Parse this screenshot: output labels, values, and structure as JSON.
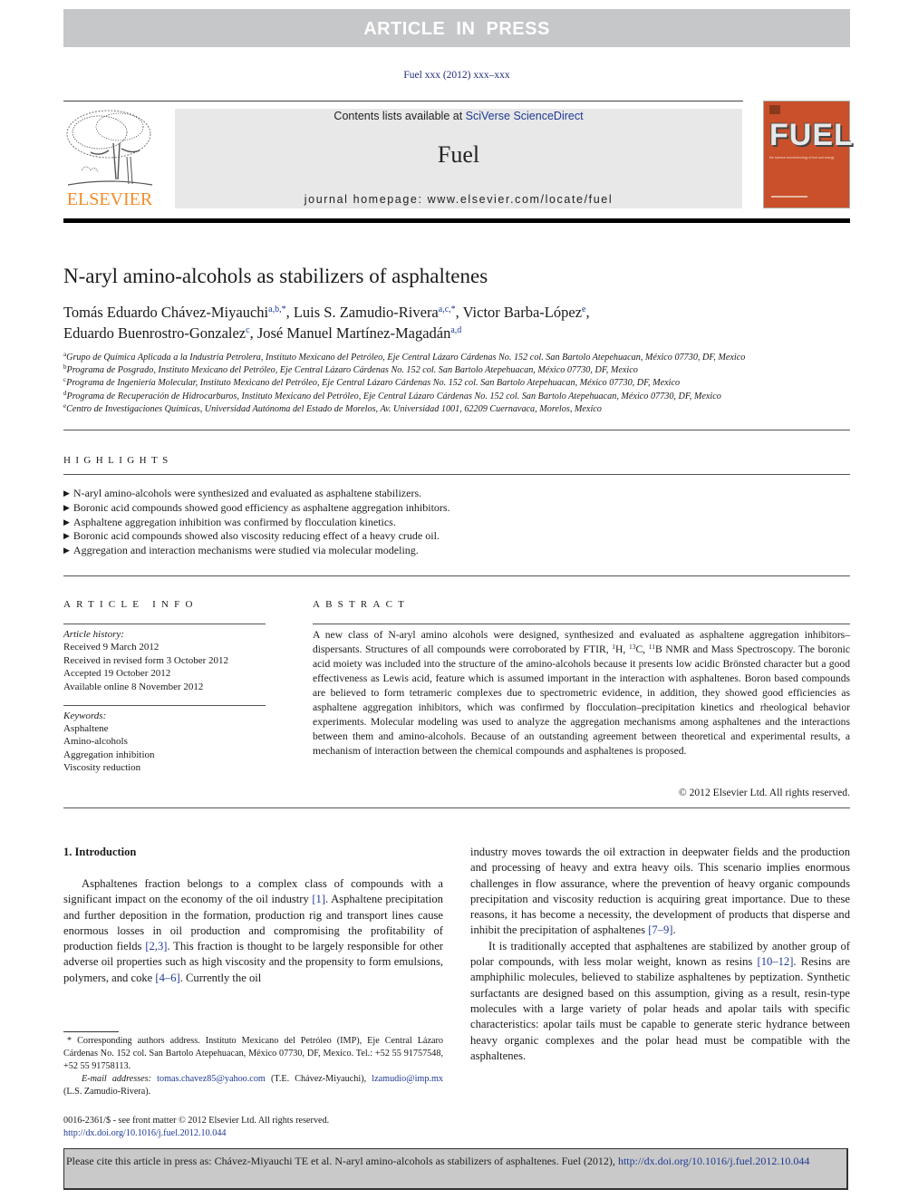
{
  "banner": {
    "text": "ARTICLE IN PRESS"
  },
  "journal_ref": "Fuel xxx (2012) xxx–xxx",
  "masthead": {
    "publisher_logo_text": "ELSEVIER",
    "contents_prefix": "Contents lists available at ",
    "contents_link": "SciVerse ScienceDirect",
    "journal_name": "Fuel",
    "homepage": "journal homepage: www.elsevier.com/locate/fuel",
    "cover_title": "FUEL",
    "cover_subtitle": "the science and technology of fuel and energy",
    "brand_color": "#f28c28",
    "cover_color": "#c9502a"
  },
  "article": {
    "title": "N-aryl amino-alcohols as stabilizers of asphaltenes",
    "authors": [
      {
        "name": "Tomás Eduardo Chávez-Miyauchi",
        "sup": "a,b,*",
        "sep": ", "
      },
      {
        "name": "Luis S. Zamudio-Rivera",
        "sup": "a,c,*",
        "sep": ", "
      },
      {
        "name": "Victor Barba-López",
        "sup": "e",
        "sep": ","
      },
      {
        "name": "Eduardo Buenrostro-Gonzalez",
        "sup": "c",
        "sep": ", "
      },
      {
        "name": "José Manuel Martínez-Magadán",
        "sup": "a,d",
        "sep": ""
      }
    ],
    "affiliations": [
      {
        "key": "a",
        "text": "Grupo de Química Aplicada a la Industria Petrolera, Instituto Mexicano del Petróleo, Eje Central Lázaro Cárdenas No. 152 col. San Bartolo Atepehuacan, México 07730, DF, Mexico"
      },
      {
        "key": "b",
        "text": "Programa de Posgrado, Instituto Mexicano del Petróleo, Eje Central Lázaro Cárdenas No. 152 col. San Bartolo Atepehuacan, México 07730, DF, Mexico"
      },
      {
        "key": "c",
        "text": "Programa de Ingeniería Molecular, Instituto Mexicano del Petróleo, Eje Central Lázaro Cárdenas No. 152 col. San Bartolo Atepehuacan, México 07730, DF, Mexico"
      },
      {
        "key": "d",
        "text": "Programa de Recuperación de Hidrocarburos, Instituto Mexicano del Petróleo, Eje Central Lázaro Cárdenas No. 152 col. San Bartolo Atepehuacan, México 07730, DF, Mexico"
      },
      {
        "key": "e",
        "text": "Centro de Investigaciones Químicas, Universidad Autónoma del Estado de Morelos, Av. Universidad 1001, 62209 Cuernavaca, Morelos, Mexico"
      }
    ]
  },
  "highlights": {
    "heading": "HIGHLIGHTS",
    "bullet_icon": "▶",
    "items": [
      "N-aryl amino-alcohols were synthesized and evaluated as asphaltene stabilizers.",
      "Boronic acid compounds showed good efficiency as asphaltene aggregation inhibitors.",
      "Asphaltene aggregation inhibition was confirmed by flocculation kinetics.",
      "Boronic acid compounds showed also viscosity reducing effect of a heavy crude oil.",
      "Aggregation and interaction mechanisms were studied via molecular modeling."
    ]
  },
  "article_info": {
    "heading": "ARTICLE INFO",
    "history_label": "Article history:",
    "history": [
      "Received 9 March 2012",
      "Received in revised form 3 October 2012",
      "Accepted 19 October 2012",
      "Available online 8 November 2012"
    ],
    "keywords_label": "Keywords:",
    "keywords": [
      "Asphaltene",
      "Amino-alcohols",
      "Aggregation inhibition",
      "Viscosity reduction"
    ]
  },
  "abstract": {
    "heading": "ABSTRACT",
    "part1": "A new class of N-aryl amino alcohols were designed, synthesized and evaluated as asphaltene aggregation inhibitors–dispersants. Structures of all compounds were corroborated by FTIR, ",
    "sup_h": "1",
    "h": "H, ",
    "sup_c": "13",
    "c": "C, ",
    "sup_b": "11",
    "part2": "B NMR and Mass Spectroscopy. The boronic acid moiety was included into the structure of the amino-alcohols because it presents low acidic Brönsted character but a good effectiveness as Lewis acid, feature which is assumed important in the interaction with asphaltenes. Boron based compounds are believed to form tetrameric complexes due to spectrometric evidence, in addition, they showed good efficiencies as asphaltene aggregation inhibitors, which was confirmed by flocculation–precipitation kinetics and rheological behavior experiments. Molecular modeling was used to analyze the aggregation mechanisms among asphaltenes and the interactions between them and amino-alcohols. Because of an outstanding agreement between theoretical and experimental results, a mechanism of interaction between the chemical compounds and asphaltenes is proposed.",
    "copyright": "© 2012 Elsevier Ltd. All rights reserved."
  },
  "introduction": {
    "heading": "1. Introduction",
    "left_p1": [
      "Asphaltenes fraction belongs to a complex class of compounds with a significant impact on the economy of the oil industry ",
      "[1]",
      ". Asphaltene precipitation and further deposition in the formation, production rig and transport lines cause enormous losses in oil production and compromising the profitability of production fields ",
      "[2,3]",
      ". This fraction is thought to be largely responsible for other adverse oil properties such as high viscosity and the propensity to form emulsions, polymers, and coke ",
      "[4–6]",
      ". Currently the oil"
    ],
    "right_p1": [
      "industry moves towards the oil extraction in deepwater fields and the production and processing of heavy and extra heavy oils. This scenario implies enormous challenges in flow assurance, where the prevention of heavy organic compounds precipitation and viscosity reduction is acquiring great importance. Due to these reasons, it has become a necessity, the development of products that disperse and inhibit the precipitation of asphaltenes ",
      "[7–9]",
      "."
    ],
    "right_p2": [
      "It is traditionally accepted that asphaltenes are stabilized by another group of polar compounds, with less molar weight, known as resins ",
      "[10–12]",
      ". Resins are amphiphilic molecules, believed to stabilize asphaltenes by peptization. Synthetic surfactants are designed based on this assumption, giving as a result, resin-type molecules with a large variety of polar heads and apolar tails with specific characteristics: apolar tails must be capable to generate steric hydrance between heavy organic complexes and the polar head must be compatible with the asphaltenes."
    ]
  },
  "footnote": {
    "corresponding": "* Corresponding authors address. Instituto Mexicano del Petróleo (IMP), Eje Central Lázaro Cárdenas No. 152 col. San Bartolo Atepehuacan, México 07730, DF, Mexico. Tel.: +52 55 91757548, +52 55 91758113.",
    "email_label": "E-mail addresses: ",
    "email1": "tomas.chavez85@yahoo.com",
    "email1_owner": " (T.E. Chávez-Miyauchi), ",
    "email2": "lzamudio@imp.mx",
    "email2_owner": " (L.S. Zamudio-Rivera)."
  },
  "issn": {
    "line": "0016-2361/$ - see front matter © 2012 Elsevier Ltd. All rights reserved.",
    "doi": "http://dx.doi.org/10.1016/j.fuel.2012.10.044"
  },
  "cite_box": {
    "text": "Please cite this article in press as: Chávez-Miyauchi TE et al. N-aryl amino-alcohols as stabilizers of asphaltenes. Fuel (2012), ",
    "link": "http://dx.doi.org/10.1016/j.fuel.2012.10.044"
  }
}
